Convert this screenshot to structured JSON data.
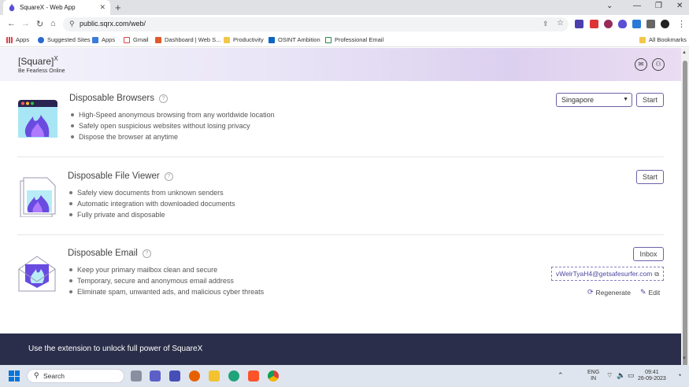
{
  "browser": {
    "tab_title": "SquareX - Web App",
    "url": "public.sqrx.com/web/",
    "bookmarks": [
      "Apps",
      "Suggested Sites",
      "Apps",
      "Gmail",
      "Dashboard | Web S...",
      "Productivity",
      "OSINT Ambition",
      "Professional Email"
    ],
    "all_bookmarks": "All Bookmarks"
  },
  "header": {
    "brand": "[Square]",
    "brand_sup": "X",
    "tagline": "Be Fearless Online"
  },
  "cards": {
    "browsers": {
      "title": "Disposable Browsers",
      "bullets": [
        "High-Speed anonymous browsing from any worldwide location",
        "Safely open suspicious websites without losing privacy",
        "Dispose the browser at anytime"
      ],
      "location": "Singapore",
      "start": "Start"
    },
    "viewer": {
      "title": "Disposable File Viewer",
      "bullets": [
        "Safely view documents from unknown senders",
        "Automatic integration with downloaded documents",
        "Fully private and disposable"
      ],
      "start": "Start"
    },
    "email": {
      "title": "Disposable Email",
      "bullets": [
        "Keep your primary mailbox clean and secure",
        "Temporary, secure and anonymous email address",
        "Eliminate spam, unwanted ads, and malicious cyber threats"
      ],
      "inbox": "Inbox",
      "address": "vWelrTyaH4@getsafesurfer.com",
      "regenerate": "Regenerate",
      "edit": "Edit"
    }
  },
  "footer": {
    "text": "Use the extension to unlock full power of SquareX"
  },
  "taskbar": {
    "search": "Search",
    "lang": "ENG",
    "region": "IN",
    "time": "09:41",
    "date": "26-09-2023"
  },
  "colors": {
    "accent": "#6b63a8",
    "footer_bg": "#2b2e4a"
  }
}
